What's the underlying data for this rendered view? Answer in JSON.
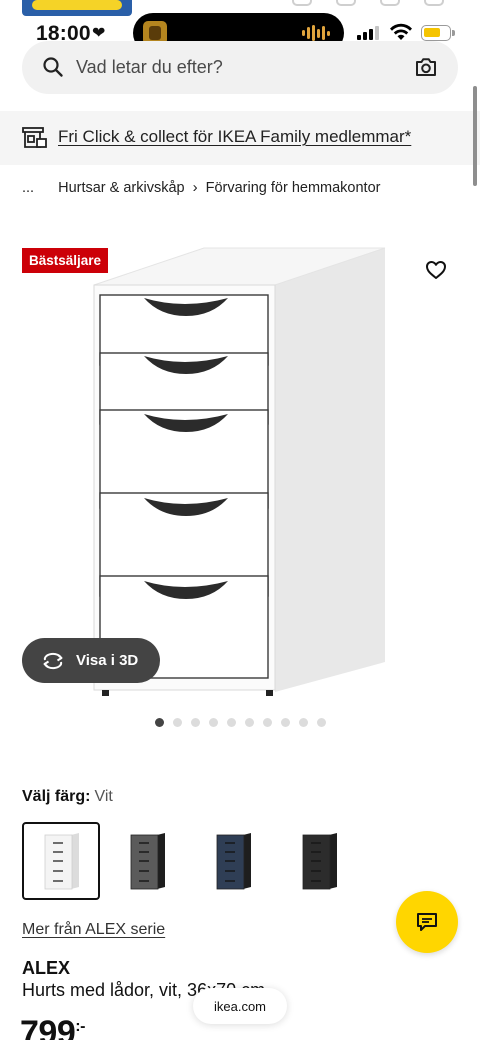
{
  "status_bar": {
    "time": "18:00"
  },
  "search": {
    "placeholder": "Vad letar du efter?"
  },
  "promo": {
    "text": "Fri Click & collect för IKEA Family medlemmar*"
  },
  "breadcrumb": {
    "ellipsis": "...",
    "items": [
      "Hurtsar & arkivskåp",
      "Förvaring för hemmakontor"
    ],
    "separator": "›"
  },
  "product": {
    "badge": "Bästsäljare",
    "view_3d_label": "Visa i 3D",
    "image_count": 10,
    "active_image_index": 0,
    "color_label": "Välj färg:",
    "color_value": "Vit",
    "swatches": [
      {
        "name": "Vit",
        "color": "#f4f4f4",
        "selected": true
      },
      {
        "name": "Grå",
        "color": "#5b5b5b",
        "selected": false
      },
      {
        "name": "Blå",
        "color": "#2f3e55",
        "selected": false
      },
      {
        "name": "Svartbrun",
        "color": "#2c2c2c",
        "selected": false
      }
    ],
    "series_link": "Mer från ALEX serie",
    "name": "ALEX",
    "description": "Hurts med lådor, vit, 36x70 cm",
    "price": "799",
    "price_suffix": ":-"
  },
  "browser": {
    "url": "ikea.com"
  },
  "colors": {
    "badge": "#cc0008",
    "chat_fab": "#ffd600",
    "battery": "#f5c400"
  }
}
